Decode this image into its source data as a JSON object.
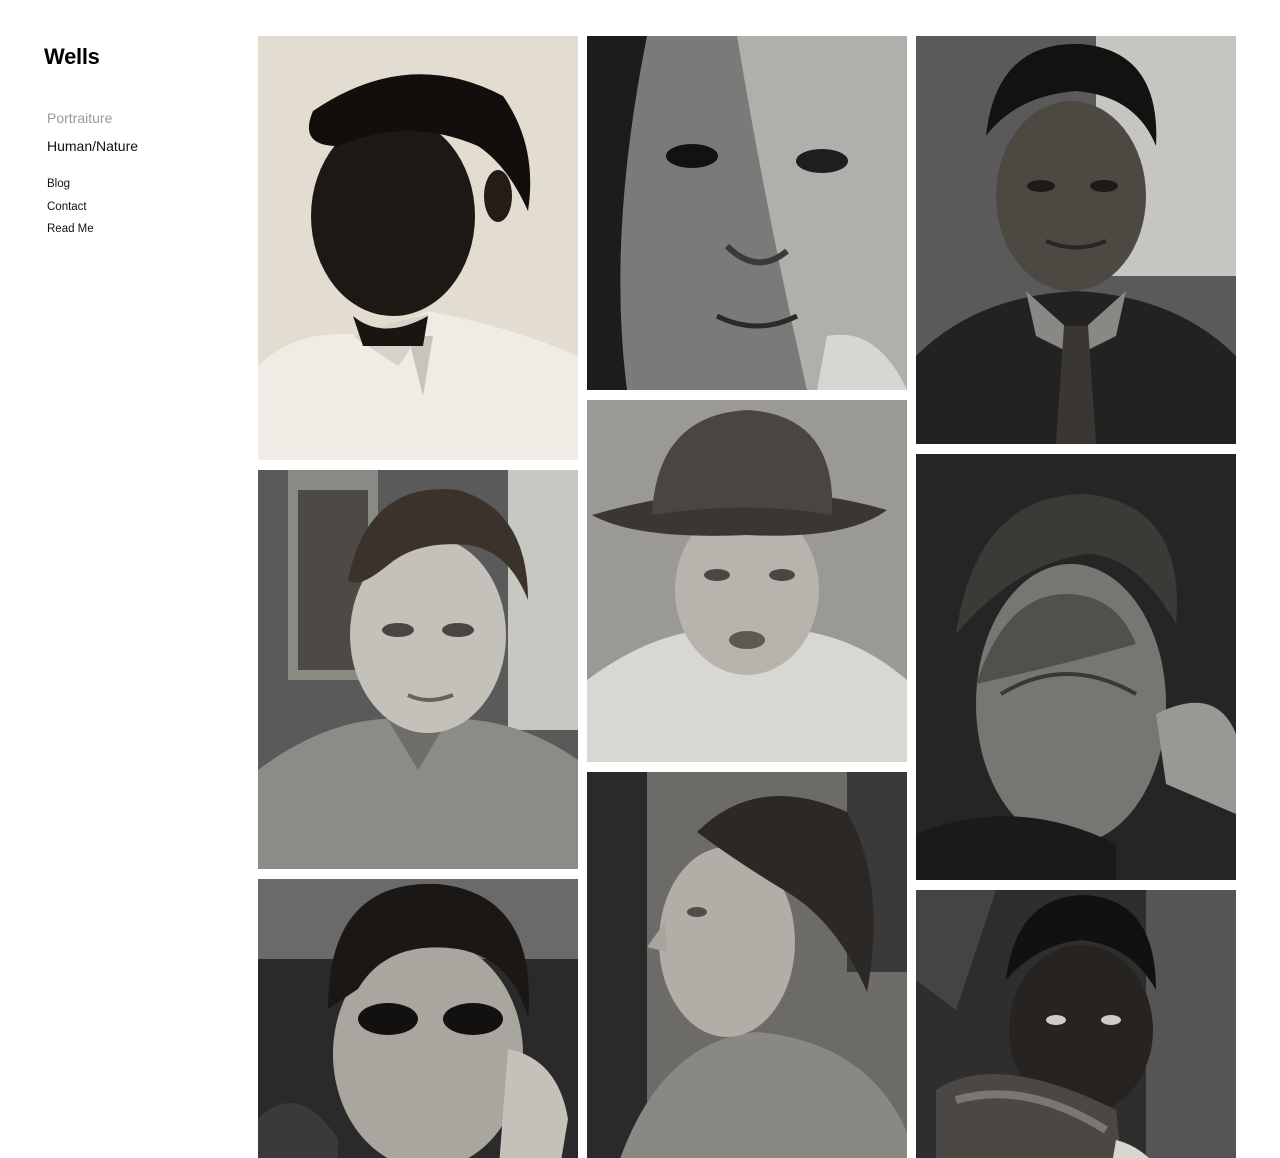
{
  "site": {
    "title": "Wells"
  },
  "gallery_nav": {
    "items": [
      {
        "label": "Portraiture",
        "state": "inactive"
      },
      {
        "label": "Human/Nature",
        "state": "active"
      }
    ]
  },
  "page_nav": {
    "items": [
      {
        "label": "Blog"
      },
      {
        "label": "Contact"
      },
      {
        "label": "Read Me"
      }
    ]
  },
  "colors": {
    "background": "#ffffff",
    "title": "#000000",
    "nav_inactive": "#9a9a9a",
    "nav_active": "#111111"
  }
}
